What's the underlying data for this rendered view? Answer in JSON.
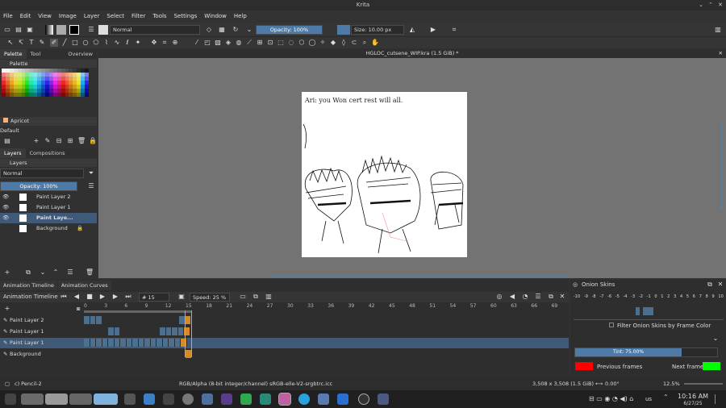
{
  "window": {
    "title": "Krita"
  },
  "menu": [
    "File",
    "Edit",
    "View",
    "Image",
    "Layer",
    "Select",
    "Filter",
    "Tools",
    "Settings",
    "Window",
    "Help"
  ],
  "toolbar": {
    "blend_mode": "Normal",
    "opacity": "Opacity: 100%",
    "size": "Size: 10.00 px"
  },
  "left_tabs": [
    "Palette",
    "Tool Options",
    "Overview"
  ],
  "palette": {
    "title": "Palette",
    "swatch_name": "Apricot",
    "set": "Default"
  },
  "layer_tabs": [
    "Layers",
    "Compositions"
  ],
  "layers": {
    "title": "Layers",
    "blend": "Normal",
    "opacity": "Opacity: 100%",
    "items": [
      {
        "name": "Paint Layer 2"
      },
      {
        "name": "Paint Layer 1"
      },
      {
        "name": "Paint Laye..."
      },
      {
        "name": "Background"
      }
    ]
  },
  "document": {
    "tab": "HGLOC_cutsene_WIP.kra (1.5 GiB) *",
    "caption": "Ari: you Won cert rest will all."
  },
  "timeline": {
    "tabs": [
      "Animation Timeline",
      "Animation Curves"
    ],
    "title": "Animation Timeline",
    "frame": "# 15",
    "speed": "Speed: 25 %",
    "ruler": [
      "0",
      "3",
      "6",
      "9",
      "12",
      "15",
      "18",
      "21",
      "24",
      "27",
      "30",
      "33",
      "36",
      "39",
      "42",
      "45",
      "48",
      "51",
      "54",
      "57",
      "60",
      "63",
      "66",
      "69"
    ],
    "rows": [
      "Paint Layer 2",
      "Paint Layer 1",
      "Paint Layer 1",
      "Background"
    ]
  },
  "onion": {
    "title": "Onion Skins",
    "numbers": [
      "-10",
      "-9",
      "-8",
      "-7",
      "-6",
      "-5",
      "-4",
      "-3",
      "-2",
      "-1",
      "0",
      "1",
      "2",
      "3",
      "4",
      "5",
      "6",
      "7",
      "8",
      "9",
      "10"
    ],
    "filter": "Filter Onion Skins by Frame Color",
    "tint": "Tint: 75.00%",
    "prev": "Previous frames",
    "next": "Next frames",
    "prev_color": "#ff0000",
    "next_color": "#00ff00"
  },
  "status": {
    "tool": "c) Pencil-2",
    "color": "RGB/Alpha (8-bit integer/channel)  sRGB-elle-V2-srgbtrc.icc",
    "dims": "3,508 x 3,508 (1.5 GiB)",
    "rotation": "0.00°",
    "zoom": "12.5%"
  },
  "tray": {
    "lang": "us",
    "time": "10:16 AM",
    "date": "6/27/25"
  },
  "colors": {
    "accent": "#4d7aa6"
  }
}
